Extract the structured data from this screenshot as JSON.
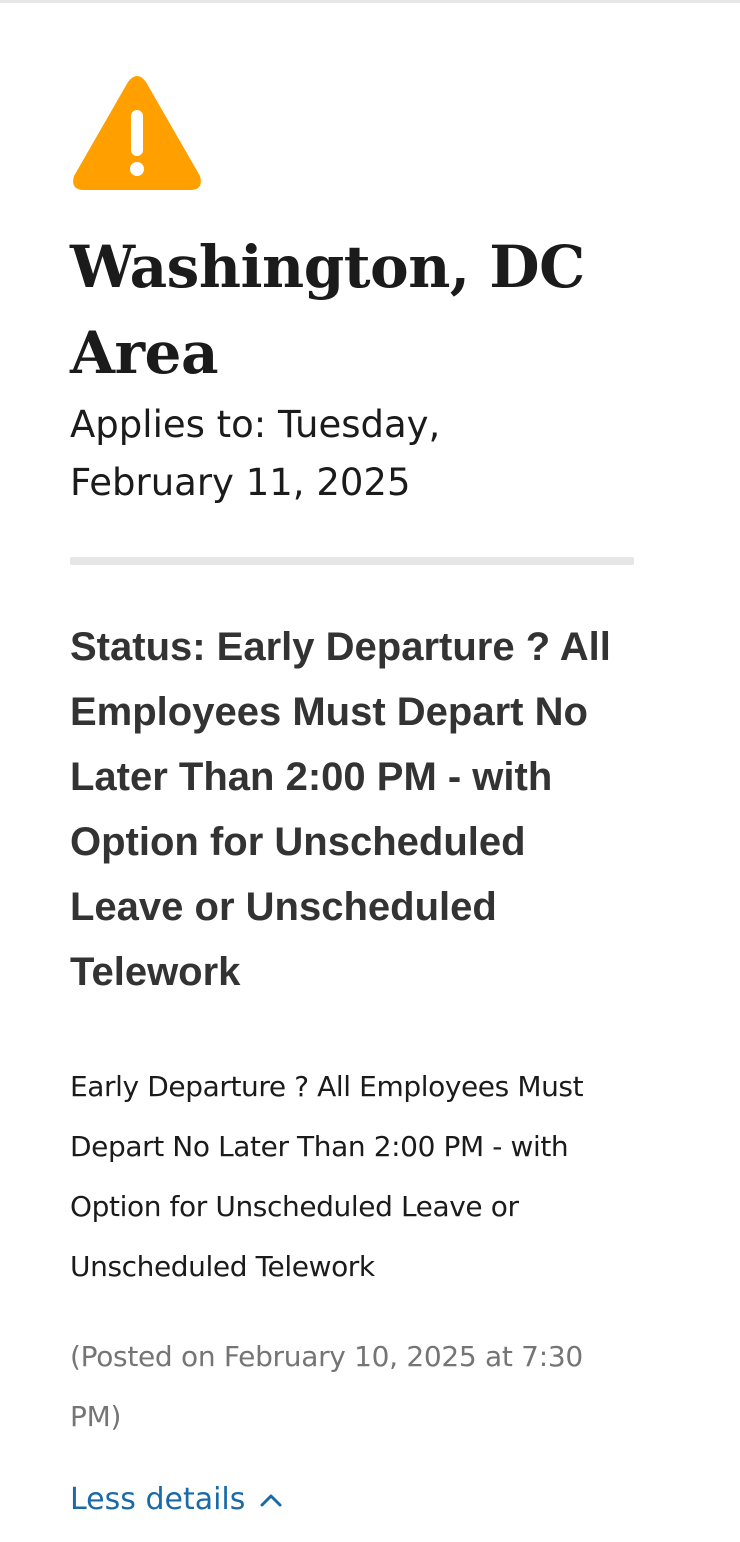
{
  "alert": {
    "icon": "warning-triangle-icon",
    "icon_color": "#FFA000",
    "title": "Washington, DC Area",
    "applies_to": "Applies to: Tuesday, February 11, 2025",
    "status_heading": "Status: Early Departure ? All Employees Must Depart No Later Than 2:00 PM - with Option for Unscheduled Leave or Unscheduled Telework",
    "description": "Early Departure ? All Employees Must Depart No Later Than 2:00 PM - with Option for Unscheduled Leave or Unscheduled Telework",
    "posted": "(Posted on February 10, 2025 at 7:30 PM)",
    "toggle_label": "Less details",
    "toggle_icon": "chevron-up-icon",
    "link_color": "#1A6AA8"
  }
}
